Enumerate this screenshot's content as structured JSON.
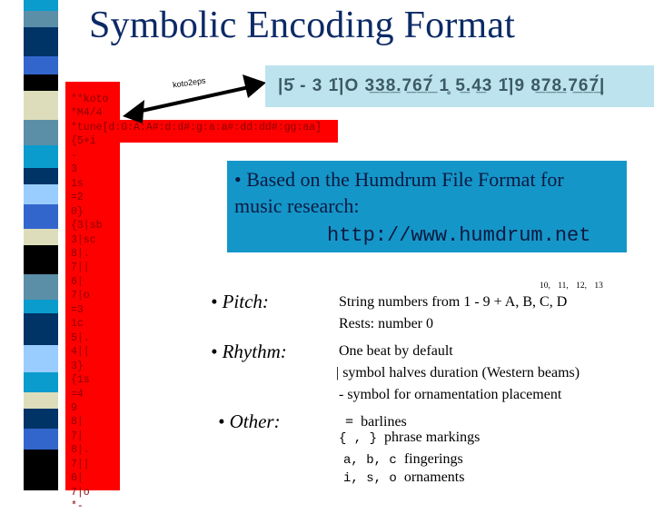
{
  "title": "Symbolic Encoding Format",
  "stripe_colors": [
    "#0a9ccd",
    "#5b8fa8",
    "#003366",
    "#3366cc",
    "#000000",
    "#ddddbb",
    "#5b8fa8",
    "#0a9ccd",
    "#003366",
    "#99ccff",
    "#3366cc",
    "#ddddbb",
    "#000000",
    "#5b8fa8",
    "#0a9ccd",
    "#003366",
    "#99ccff",
    "#0a9ccd",
    "#ddddbb",
    "#003366",
    "#3366cc",
    "#000000"
  ],
  "koto_lines": [
    "**koto",
    "*M4/4",
    "*tune[d:G:A:A#:d:d#:g:a:a#:dd:dd#:gg:aa]",
    "{5+i",
    "-",
    "3",
    "1s",
    "=2",
    "0}",
    "{3|sb",
    "3|sc",
    "8|.",
    "7||",
    "6|",
    "7|o",
    "=3",
    "1c",
    "5|.",
    "4||",
    "3}",
    "{1s",
    "=4",
    "9",
    "8|",
    "7|",
    "8|.",
    "7||",
    "6|",
    "7|o",
    "*-"
  ],
  "converter_label": "koto2eps",
  "notation": "|5̇ - 3 1̈|O 3̲3̲8̲.7̲6̲7̲́ 1̥ 5̲.4̲3 1̈|9 8̲7̲8̲.7̲6̲7̲́|",
  "info": {
    "line1": "• Based on the Humdrum File Format for",
    "line2": "music research:",
    "url": "http://www.humdrum.net"
  },
  "pitch": {
    "label": "• Pitch:",
    "superscript": "10, 11, 12, 13",
    "line1": "String numbers from 1 - 9 + A, B, C, D",
    "line2": "Rests: number 0"
  },
  "rhythm": {
    "label": "• Rhythm:",
    "line1": "One beat by default",
    "line2": "| symbol halves duration (Western beams)",
    "line3": "- symbol for ornamentation placement"
  },
  "other": {
    "label": "• Other:",
    "items": [
      {
        "sym": "=",
        "desc": "barlines"
      },
      {
        "sym": "{ , }",
        "desc": "phrase markings"
      },
      {
        "sym": "a, b, c",
        "desc": "fingerings"
      },
      {
        "sym": "i, s, o",
        "desc": "ornaments"
      }
    ]
  }
}
